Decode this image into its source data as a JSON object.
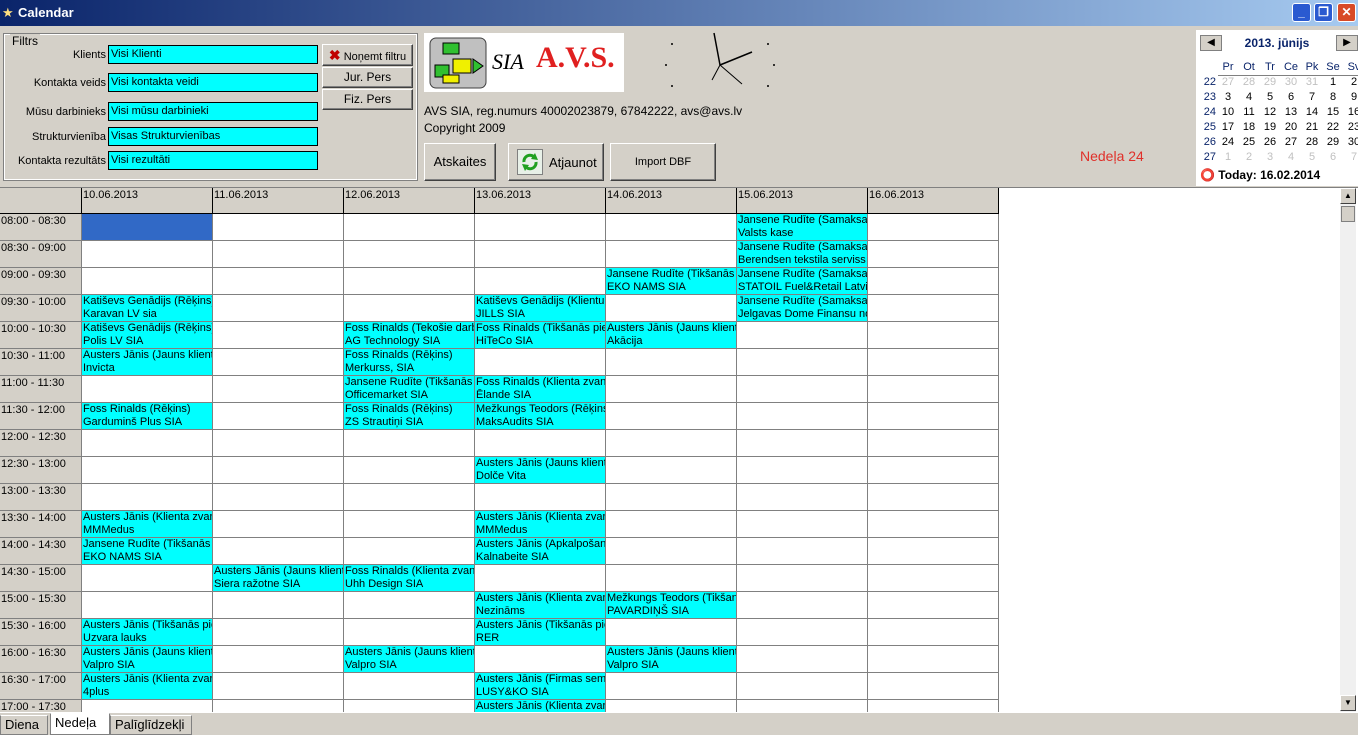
{
  "window": {
    "title": "Calendar"
  },
  "filters": {
    "legend": "Filtrs",
    "fields": [
      {
        "label": "Klients",
        "value": "Visi Klienti"
      },
      {
        "label": "Kontakta veids",
        "value": "Visi kontakta veidi"
      },
      {
        "label": "Mūsu darbinieks",
        "value": "Visi mūsu darbinieki"
      },
      {
        "label": "Strukturvienība",
        "value": "Visas Strukturvienības"
      },
      {
        "label": "Kontakta rezultāts",
        "value": "Visi rezultāti"
      }
    ],
    "clear_label": "Noņemt filtru",
    "jur_label": "Jur. Pers",
    "fiz_label": "Fiz. Pers"
  },
  "logo": {
    "prefix": "SIA",
    "name": "A.V.S."
  },
  "company": {
    "info": "AVS SIA, reg.numurs 40002023879, 67842222, avs@avs.lv",
    "copyright": "Copyright 2009"
  },
  "actions": {
    "reports_label": "Atskaites",
    "refresh_label": "Atjaunot",
    "import_label": "Import DBF"
  },
  "week_label": "Nedeļa 24",
  "calendar": {
    "month_label": "2013. jūnijs",
    "days_of_week": [
      "Pr",
      "Ot",
      "Tr",
      "Ce",
      "Pk",
      "Se",
      "Sv"
    ],
    "weeks": [
      {
        "wk": "22",
        "days": [
          "27",
          "28",
          "29",
          "30",
          "31",
          "1",
          "2"
        ]
      },
      {
        "wk": "23",
        "days": [
          "3",
          "4",
          "5",
          "6",
          "7",
          "8",
          "9"
        ]
      },
      {
        "wk": "24",
        "days": [
          "10",
          "11",
          "12",
          "13",
          "14",
          "15",
          "16"
        ]
      },
      {
        "wk": "25",
        "days": [
          "17",
          "18",
          "19",
          "20",
          "21",
          "22",
          "23"
        ]
      },
      {
        "wk": "26",
        "days": [
          "24",
          "25",
          "26",
          "27",
          "28",
          "29",
          "30"
        ]
      },
      {
        "wk": "27",
        "days": [
          "1",
          "2",
          "3",
          "4",
          "5",
          "6",
          "7"
        ]
      }
    ],
    "today_label": "Today: 16.02.2014"
  },
  "grid": {
    "dates": [
      "10.06.2013",
      "11.06.2013",
      "12.06.2013",
      "13.06.2013",
      "14.06.2013",
      "15.06.2013",
      "16.06.2013"
    ],
    "times": [
      "08:00 - 08:30",
      "08:30 - 09:00",
      "09:00 - 09:30",
      "09:30 - 10:00",
      "10:00 - 10:30",
      "10:30 - 11:00",
      "11:00 - 11:30",
      "11:30 - 12:00",
      "12:00 - 12:30",
      "12:30 - 13:00",
      "13:00 - 13:30",
      "13:30 - 14:00",
      "14:00 - 14:30",
      "14:30 - 15:00",
      "15:00 - 15:30",
      "15:30 - 16:00",
      "16:00 - 16:30",
      "16:30 - 17:00",
      "17:00 - 17:30"
    ],
    "events": [
      {
        "day": 5,
        "slot": 0,
        "line1": "Jansene Rudīte (Samaksa)",
        "line2": "Valsts kase"
      },
      {
        "day": 5,
        "slot": 1,
        "line1": "Jansene Rudīte (Samaksa)",
        "line2": "Berendsen tekstila serviss A"
      },
      {
        "day": 4,
        "slot": 2,
        "line1": "Jansene Rudīte (Tikšanās p",
        "line2": "EKO NAMS SIA"
      },
      {
        "day": 5,
        "slot": 2,
        "line1": "Jansene Rudīte (Samaksa)",
        "line2": "STATOIL Fuel&Retail Latvia"
      },
      {
        "day": 0,
        "slot": 3,
        "line1": "Katiševs Genādijs (Rēķins)",
        "line2": "Karavan LV sia"
      },
      {
        "day": 3,
        "slot": 3,
        "line1": "Katiševs Genādijs (Klientu p",
        "line2": "JILLS SIA"
      },
      {
        "day": 5,
        "slot": 3,
        "line1": "Jansene Rudīte (Samaksa)",
        "line2": "Jelgavas Dome Finansu no"
      },
      {
        "day": 0,
        "slot": 4,
        "line1": "Katiševs Genādijs (Rēķins)",
        "line2": "Polis LV SIA"
      },
      {
        "day": 2,
        "slot": 4,
        "line1": "Foss Rinalds (Tekošie darbi",
        "line2": "AG Technology SIA"
      },
      {
        "day": 3,
        "slot": 4,
        "line1": "Foss Rinalds (Tikšanās pie",
        "line2": "HiTeCo SIA"
      },
      {
        "day": 4,
        "slot": 4,
        "line1": "Austers Jānis (Jauns klients",
        "line2": "Akācija"
      },
      {
        "day": 0,
        "slot": 5,
        "line1": "Austers Jānis (Jauns klients",
        "line2": "Invicta"
      },
      {
        "day": 2,
        "slot": 5,
        "line1": "Foss Rinalds (Rēķins)",
        "line2": "Merkurss, SIA"
      },
      {
        "day": 2,
        "slot": 6,
        "line1": "Jansene Rudīte (Tikšanās p",
        "line2": "Officemarket SIA"
      },
      {
        "day": 3,
        "slot": 6,
        "line1": "Foss Rinalds (Klienta zvans",
        "line2": "Ēlande SIA"
      },
      {
        "day": 0,
        "slot": 7,
        "line1": "Foss Rinalds (Rēķins)",
        "line2": "Garduminš Plus SIA"
      },
      {
        "day": 2,
        "slot": 7,
        "line1": "Foss Rinalds (Rēķins)",
        "line2": "ZS Strautiņi SIA"
      },
      {
        "day": 3,
        "slot": 7,
        "line1": "Mežkungs Teodors (Rēķins",
        "line2": "MaksAudits SIA"
      },
      {
        "day": 3,
        "slot": 9,
        "line1": "Austers Jānis (Jauns klients",
        "line2": "Dolče Vita"
      },
      {
        "day": 0,
        "slot": 11,
        "line1": "Austers Jānis (Klienta zvans",
        "line2": "MMMedus"
      },
      {
        "day": 3,
        "slot": 11,
        "line1": "Austers Jānis (Klienta zvans",
        "line2": "MMMedus"
      },
      {
        "day": 0,
        "slot": 12,
        "line1": "Jansene Rudīte (Tikšanās p",
        "line2": "EKO NAMS SIA"
      },
      {
        "day": 3,
        "slot": 12,
        "line1": "Austers Jānis (Apkalpošana",
        "line2": "Kalnabeite SIA"
      },
      {
        "day": 1,
        "slot": 13,
        "line1": "Austers Jānis (Jauns klients",
        "line2": "Siera ražotne SIA"
      },
      {
        "day": 2,
        "slot": 13,
        "line1": "Foss Rinalds (Klienta zvans",
        "line2": "Uhh Design SIA"
      },
      {
        "day": 3,
        "slot": 14,
        "line1": "Austers Jānis (Klienta zvans",
        "line2": "Nezināms"
      },
      {
        "day": 4,
        "slot": 14,
        "line1": "Mežkungs Teodors (Tikšan",
        "line2": "PAVARDIŅŠ SIA"
      },
      {
        "day": 0,
        "slot": 15,
        "line1": "Austers Jānis (Tikšanās pie",
        "line2": "Uzvara lauks"
      },
      {
        "day": 3,
        "slot": 15,
        "line1": "Austers Jānis (Tikšanās pie",
        "line2": "RER"
      },
      {
        "day": 0,
        "slot": 16,
        "line1": "Austers Jānis (Jauns klients",
        "line2": "Valpro SIA"
      },
      {
        "day": 2,
        "slot": 16,
        "line1": "Austers Jānis (Jauns klients",
        "line2": "Valpro SIA"
      },
      {
        "day": 4,
        "slot": 16,
        "line1": "Austers Jānis (Jauns klients",
        "line2": "Valpro SIA"
      },
      {
        "day": 0,
        "slot": 17,
        "line1": "Austers Jānis (Klienta zvans",
        "line2": "4plus"
      },
      {
        "day": 3,
        "slot": 17,
        "line1": "Austers Jānis (Firmas semin",
        "line2": "LUSY&KO SIA"
      },
      {
        "day": 3,
        "slot": 18,
        "line1": "Austers Jānis (Klienta zvans",
        "line2": ""
      }
    ]
  },
  "tabs": [
    "Diena",
    "Nedeļa",
    "Palīglīdzekļi"
  ],
  "active_tab": "Nedeļa",
  "colors": {
    "event": "#00ffff",
    "selected": "#3169c6",
    "week_label": "#e0302a"
  }
}
